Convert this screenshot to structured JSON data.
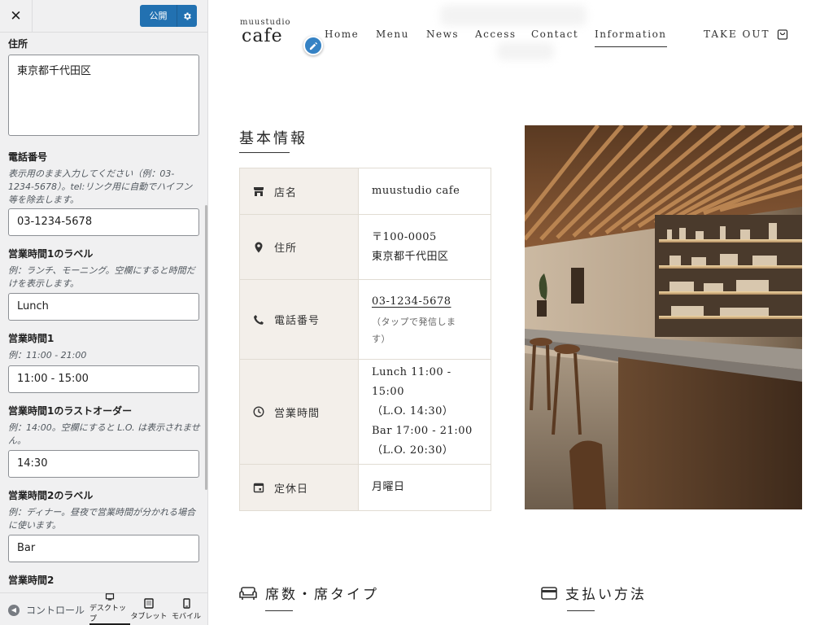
{
  "customizer": {
    "close_icon": "close-icon",
    "publish_label": "公開",
    "settings_icon": "gear-icon",
    "fields": {
      "address": {
        "label": "住所",
        "value": "東京都千代田区"
      },
      "phone": {
        "label": "電話番号",
        "description": "表示用のまま入力してください（例：03-1234-5678）。tel:リンク用に自動でハイフン等を除去します。",
        "value": "03-1234-5678"
      },
      "hours1_label": {
        "label": "営業時間1のラベル",
        "description": "例：ランチ、モーニング。空欄にすると時間だけを表示します。",
        "value": "Lunch"
      },
      "hours1": {
        "label": "営業時間1",
        "description": "例：11:00 - 21:00",
        "value": "11:00 - 15:00"
      },
      "hours1_lo": {
        "label": "営業時間1のラストオーダー",
        "description": "例：14:00。空欄にすると L.O. は表示されません。",
        "value": "14:30"
      },
      "hours2_label": {
        "label": "営業時間2のラベル",
        "description": "例：ディナー。昼夜で営業時間が分かれる場合に使います。",
        "value": "Bar"
      },
      "hours2": {
        "label": "営業時間2"
      }
    },
    "footer": {
      "collapse_label": "コントロール",
      "devices": [
        "デスクトップ",
        "タブレット",
        "モバイル"
      ]
    }
  },
  "site": {
    "logo_small": "muustudio",
    "logo_big": "cafe",
    "nav": [
      "Home",
      "Menu",
      "News",
      "Access",
      "Contact",
      "Information"
    ],
    "nav_active": "Information",
    "takeout": "TAKE OUT",
    "section_title": "基本情報",
    "rows": [
      {
        "icon": "store-icon",
        "label": "店名",
        "value": "muustudio cafe"
      },
      {
        "icon": "location-pin-icon",
        "label": "住所",
        "postal": "〒100-0005",
        "value": "東京都千代田区"
      },
      {
        "icon": "phone-icon",
        "label": "電話番号",
        "value": "03-1234-5678",
        "note": "（タップで発信しま",
        "note2": "す）"
      },
      {
        "icon": "clock-icon",
        "label": "営業時間",
        "lines": [
          "Lunch 11:00 - 15:00",
          "（L.O. 14:30）",
          "Bar 17:00 - 21:00",
          "（L.O. 20:30）"
        ]
      },
      {
        "icon": "calendar-icon",
        "label": "定休日",
        "value": "月曜日"
      }
    ],
    "seat_heading": "席数・席タイプ",
    "payment_heading": "支払い方法"
  },
  "colors": {
    "accent": "#2271b1",
    "table_header_bg": "#f3efea",
    "table_border": "#e1dcd3"
  }
}
